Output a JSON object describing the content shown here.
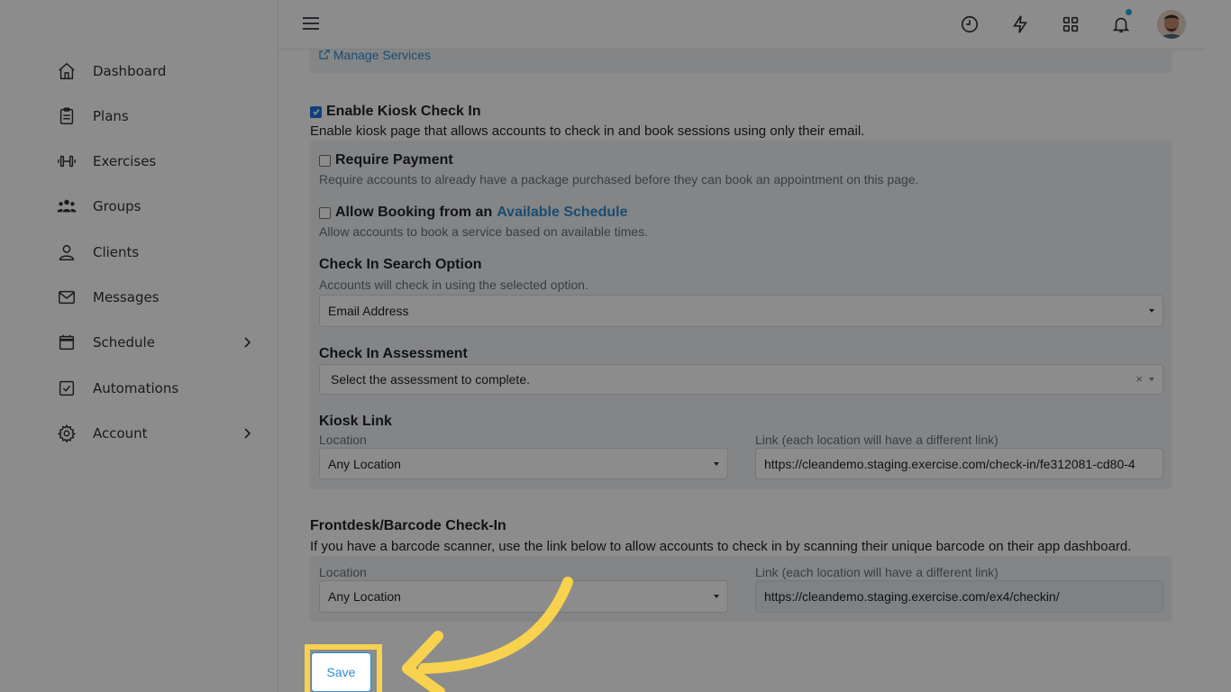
{
  "sidebar": {
    "items": [
      {
        "label": "Dashboard",
        "icon": "home-icon"
      },
      {
        "label": "Plans",
        "icon": "clipboard-icon"
      },
      {
        "label": "Exercises",
        "icon": "dumbbell-icon"
      },
      {
        "label": "Groups",
        "icon": "users-icon"
      },
      {
        "label": "Clients",
        "icon": "user-icon"
      },
      {
        "label": "Messages",
        "icon": "mail-icon"
      },
      {
        "label": "Schedule",
        "icon": "calendar-icon"
      },
      {
        "label": "Automations",
        "icon": "checkbox-icon"
      },
      {
        "label": "Account",
        "icon": "gear-icon"
      }
    ]
  },
  "topbar": {
    "icons": [
      "menu-icon",
      "clock-icon",
      "lightning-icon",
      "grid-icon",
      "bell-icon"
    ]
  },
  "content": {
    "manage_services": "Manage Services",
    "kiosk": {
      "title": "Enable Kiosk Check In",
      "checked": true,
      "description": "Enable kiosk page that allows accounts to check in and book sessions using only their email.",
      "require_payment": {
        "label": "Require Payment",
        "checked": false,
        "description": "Require accounts to already have a package purchased before they can book an appointment on this page."
      },
      "allow_booking": {
        "label_prefix": "Allow Booking from an",
        "label_accent": "Available Schedule",
        "checked": false,
        "description": "Allow accounts to book a service based on available times."
      },
      "search_option": {
        "title": "Check In Search Option",
        "description": "Accounts will check in using the selected option.",
        "value": "Email Address"
      },
      "assessment": {
        "title": "Check In Assessment",
        "placeholder": "Select the assessment to complete.",
        "clear": "×"
      },
      "kiosk_link": {
        "title": "Kiosk Link",
        "location_label": "Location",
        "location_value": "Any Location",
        "link_label": "Link (each location will have a different link)",
        "link_value": "https://cleandemo.staging.exercise.com/check-in/fe312081-cd80-4"
      }
    },
    "frontdesk": {
      "title": "Frontdesk/Barcode Check-In",
      "description": "If you have a barcode scanner, use the link below to allow accounts to check in by scanning their unique barcode on their app dashboard.",
      "location_label": "Location",
      "location_value": "Any Location",
      "link_label": "Link (each location will have a different link)",
      "link_value": "https://cleandemo.staging.exercise.com/ex4/checkin/"
    },
    "save_label": "Save"
  },
  "colors": {
    "accent": "#2e8ccf",
    "highlight": "#f8d24e",
    "notification_dot": "#27a9e0"
  }
}
